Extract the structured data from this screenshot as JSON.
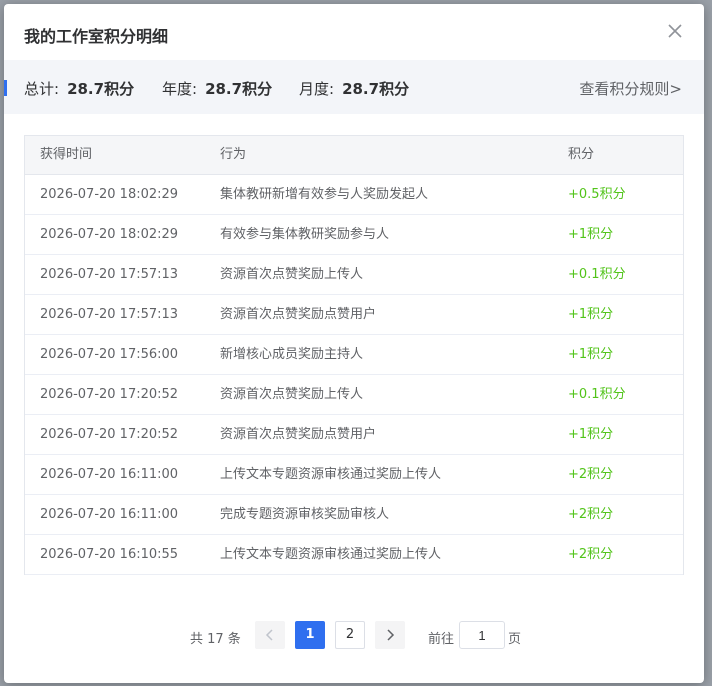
{
  "dialog": {
    "title": "我的工作室积分明细",
    "close_icon": "close-icon"
  },
  "summary": {
    "total_label": "总计:",
    "total_value": "28.7积分",
    "year_label": "年度:",
    "year_value": "28.7积分",
    "month_label": "月度:",
    "month_value": "28.7积分",
    "rules_link": "查看积分规则>"
  },
  "table": {
    "headers": [
      "获得时间",
      "行为",
      "积分"
    ],
    "rows": [
      {
        "time": "2026-07-20 18:02:29",
        "action": "集体教研新增有效参与人奖励发起人",
        "points": "+0.5积分"
      },
      {
        "time": "2026-07-20 18:02:29",
        "action": "有效参与集体教研奖励参与人",
        "points": "+1积分"
      },
      {
        "time": "2026-07-20 17:57:13",
        "action": "资源首次点赞奖励上传人",
        "points": "+0.1积分"
      },
      {
        "time": "2026-07-20 17:57:13",
        "action": "资源首次点赞奖励点赞用户",
        "points": "+1积分"
      },
      {
        "time": "2026-07-20 17:56:00",
        "action": "新增核心成员奖励主持人",
        "points": "+1积分"
      },
      {
        "time": "2026-07-20 17:20:52",
        "action": "资源首次点赞奖励上传人",
        "points": "+0.1积分"
      },
      {
        "time": "2026-07-20 17:20:52",
        "action": "资源首次点赞奖励点赞用户",
        "points": "+1积分"
      },
      {
        "time": "2026-07-20 16:11:00",
        "action": "上传文本专题资源审核通过奖励上传人",
        "points": "+2积分"
      },
      {
        "time": "2026-07-20 16:11:00",
        "action": "完成专题资源审核奖励审核人",
        "points": "+2积分"
      },
      {
        "time": "2026-07-20 16:10:55",
        "action": "上传文本专题资源审核通过奖励上传人",
        "points": "+2积分"
      }
    ]
  },
  "pagination": {
    "total_text": "共 17 条",
    "pages": [
      "1",
      "2"
    ],
    "current_page": "1",
    "goto_label": "前往",
    "goto_value": "1",
    "goto_suffix": "页"
  },
  "colors": {
    "accent": "#2f6fef",
    "points_green": "#52c41a"
  }
}
